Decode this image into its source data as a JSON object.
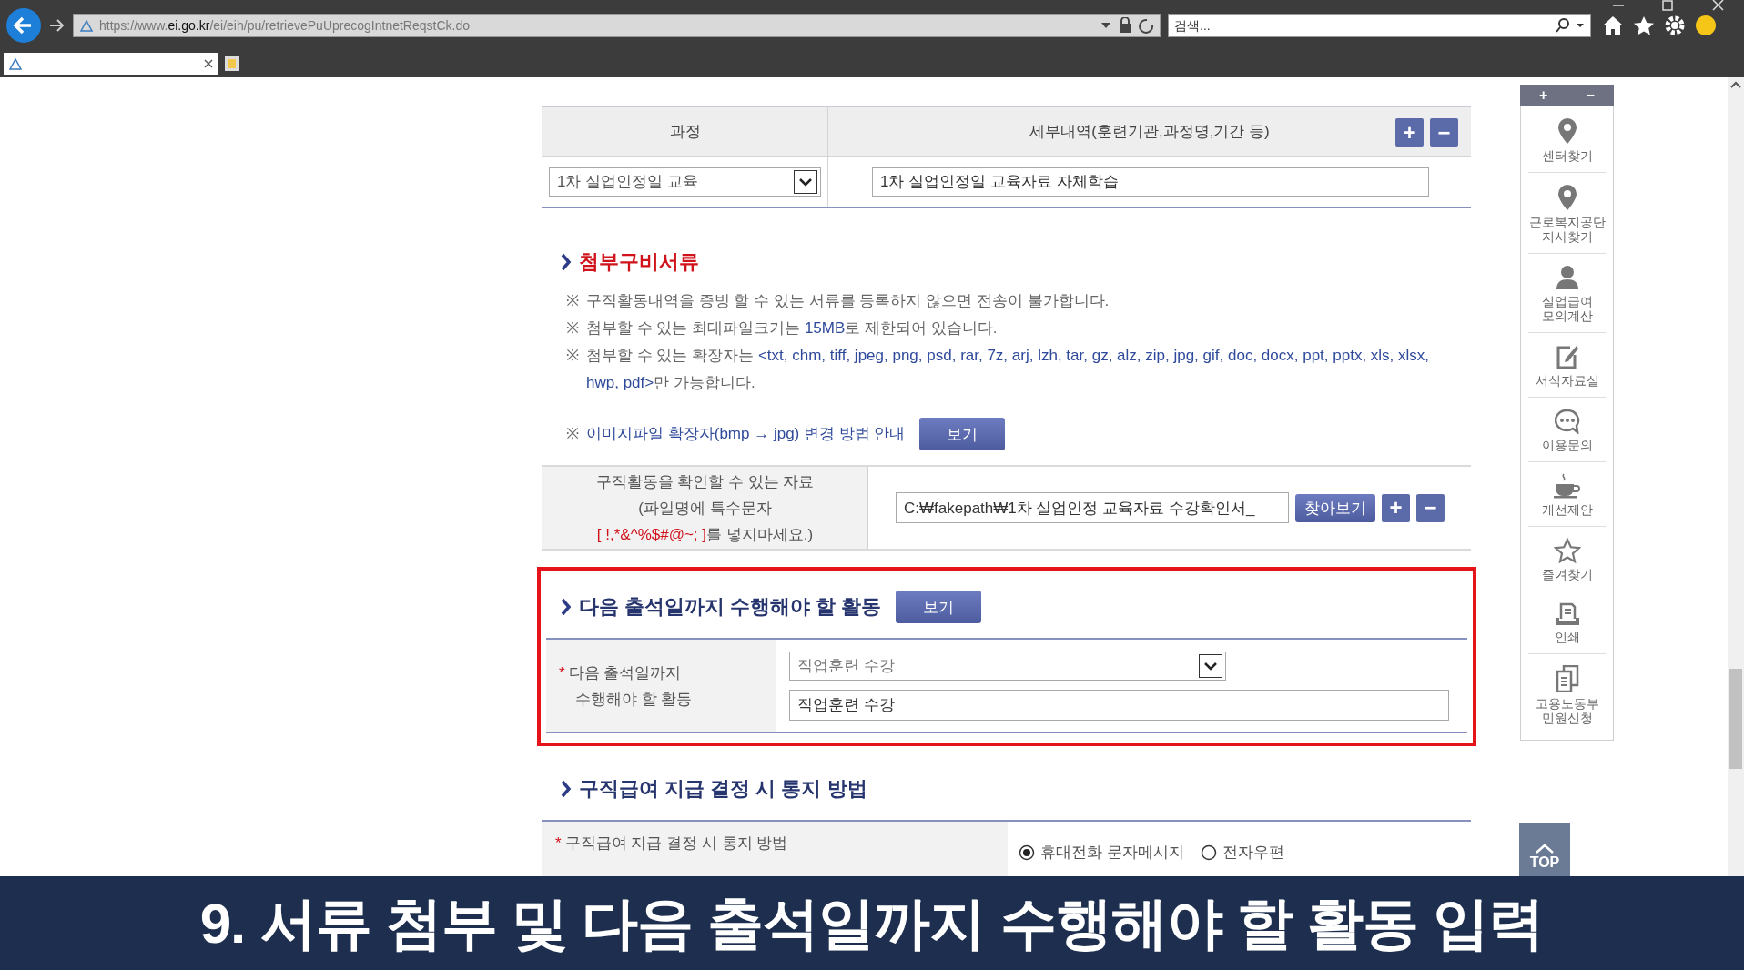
{
  "browser": {
    "url": "https://www.**ei.go.kr**/ei/eih/pu/retrievePuUprecogIntnetReqstCk.do",
    "search_placeholder": "검색..."
  },
  "course_table": {
    "columns": [
      "과정",
      "세부내역(훈련기관,과정명,기간 등)"
    ],
    "add_button": "+",
    "remove_button": "−",
    "course_select": "1차 실업인정일 교육",
    "detail_value": "1차 실업인정일 교육자료 자체학습"
  },
  "attachments": {
    "title": "첨부구비서류",
    "notes": [
      {
        "mark": "※",
        "parts": [
          {
            "text": "구직활동내역을 증빙 할 수 있는 서류를 등록하지 않으면 전송이 불가합니다.",
            "emphasis": false
          }
        ]
      },
      {
        "mark": "※",
        "parts": [
          {
            "text": "첨부할 수 있는 최대파일크기는 ",
            "emphasis": false
          },
          {
            "text": "15MB",
            "emphasis": true
          },
          {
            "text": "로 제한되어 있습니다.",
            "emphasis": false
          }
        ]
      },
      {
        "mark": "※",
        "parts": [
          {
            "text": "첨부할 수 있는 확장자는 ",
            "emphasis": false
          },
          {
            "text": "<txt, chm, tiff, jpeg, png, psd, rar, 7z, arj, lzh, tar, gz, alz, zip, jpg, gif, doc, docx, ppt, pptx, xls, xlsx, hwp, pdf>",
            "emphasis": true
          },
          {
            "text": "만 가능합니다.",
            "emphasis": false
          }
        ]
      }
    ],
    "image_guide": {
      "mark": "※",
      "text": "이미지파일 확장자(bmp → jpg) 변경 방법 안내",
      "button": "보기"
    },
    "file_row": {
      "label_lines": [
        "구직활동을 확인할 수 있는 자료",
        "(파일명에 특수문자"
      ],
      "warning": "[ !,*&^%$#@~; ]",
      "warning_suffix": "를 넣지마세요.)",
      "file_value": "C:₩fakepath₩1차 실업인정 교육자료 수강확인서_",
      "browse_button": "찾아보기",
      "add_button": "+",
      "remove_button": "−"
    }
  },
  "activity": {
    "title": "다음 출석일까지 수행해야 할 활동",
    "view_button": "보기",
    "highlighted": true,
    "required_mark": "*",
    "label_lines": [
      "다음 출석일까지",
      "수행해야 할 활동"
    ],
    "select_value": "직업훈련 수강",
    "input_value": "직업훈련 수강"
  },
  "notify": {
    "title": "구직급여 지급 결정 시 통지 방법",
    "required_mark": "*",
    "label": "구직급여 지급 결정 시 통지 방법",
    "options": [
      {
        "label": "휴대전화 문자메시지",
        "selected": true
      },
      {
        "label": "전자우편",
        "selected": false
      }
    ]
  },
  "quick_menu": {
    "zoom_in": "+",
    "zoom_out": "−",
    "items": [
      {
        "kind": "pin",
        "label_lines": [
          "센터찾기"
        ]
      },
      {
        "kind": "pin",
        "label_lines": [
          "근로복지공단",
          "지사찾기"
        ]
      },
      {
        "kind": "person",
        "label_lines": [
          "실업급여",
          "모의계산"
        ]
      },
      {
        "kind": "edit",
        "label_lines": [
          "서식자료실"
        ]
      },
      {
        "kind": "chat",
        "label_lines": [
          "이용문의"
        ]
      },
      {
        "kind": "cup",
        "label_lines": [
          "개선제안"
        ]
      },
      {
        "kind": "star",
        "label_lines": [
          "즐겨찾기"
        ]
      },
      {
        "kind": "print",
        "label_lines": [
          "인쇄"
        ]
      },
      {
        "kind": "docs",
        "label_lines": [
          "고용노동부",
          "민원신청"
        ]
      }
    ]
  },
  "top_button": "TOP",
  "caption": "9. 서류 첨부 및 다음 출석일까지 수행해야 할 활동 입력"
}
